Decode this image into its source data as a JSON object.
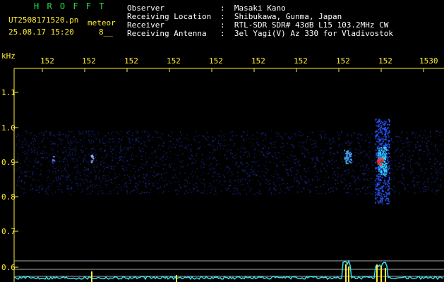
{
  "header": {
    "brand": "H R O F F T",
    "filename": "UT2508171520.pn",
    "tag": "meteor",
    "datetime": "25.08.17 15:20",
    "extra": "8__",
    "fields": [
      {
        "label": "Observer",
        "value": ":  Masaki Kano"
      },
      {
        "label": "Receiving Location",
        "value": ":  Shibukawa, Gunma, Japan"
      },
      {
        "label": "Receiver",
        "value": ":  RTL-SDR SDR# 43dB L15 103.2MHz CW"
      },
      {
        "label": "Receiving Antenna",
        "value": ":  3el Yagi(V) Az 330 for Vladivostok"
      }
    ]
  },
  "time_axis": {
    "ticks": [
      "152",
      "152",
      "152",
      "152",
      "152",
      "152",
      "152",
      "152",
      "152",
      "1530"
    ]
  },
  "freq_axis": {
    "unit": "kHz",
    "ticks": [
      "1.1",
      "1.0",
      "0.9",
      "0.8",
      "0.7",
      "0.6"
    ]
  },
  "colors": {
    "background": "#000000",
    "text": "#ffffff",
    "accent": "#ffee33",
    "brand": "#22dd44",
    "noise": "#1a2f9a",
    "trace": "#33e0ee"
  }
}
